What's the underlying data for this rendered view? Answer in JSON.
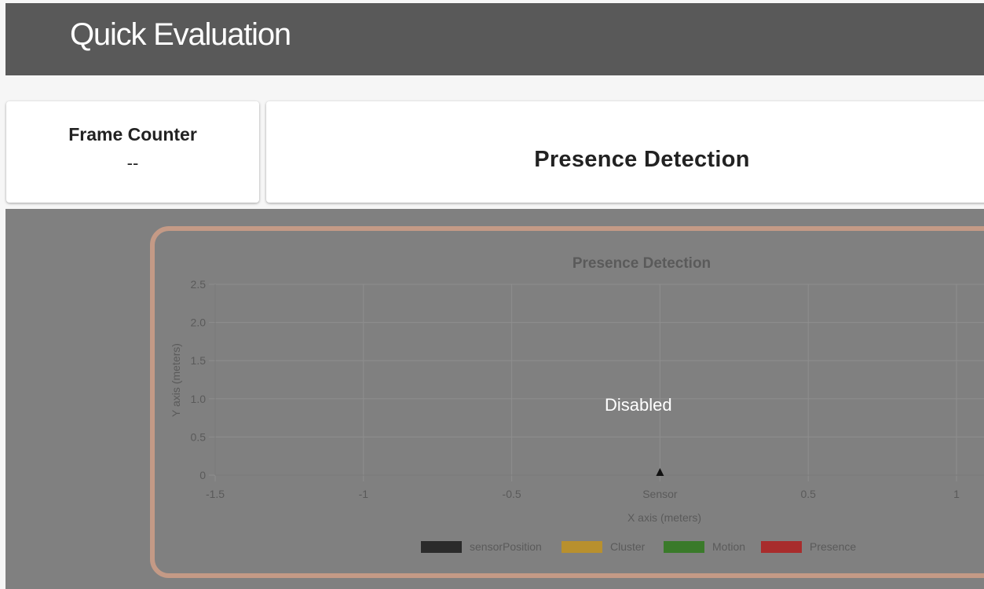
{
  "header": {
    "title": "Quick Evaluation"
  },
  "frame_counter": {
    "label": "Frame Counter",
    "value": "--"
  },
  "presence_card": {
    "title": "Presence Detection"
  },
  "overlay": {
    "status": "Disabled"
  },
  "chart_data": {
    "type": "scatter",
    "title": "Presence Detection",
    "xlabel": "X axis (meters)",
    "ylabel": "Y axis (meters)",
    "xlim": [
      -1.5,
      1.1
    ],
    "ylim": [
      0,
      2.5
    ],
    "x_ticks": [
      {
        "value": -1.5,
        "label": "-1.5"
      },
      {
        "value": -1,
        "label": "-1"
      },
      {
        "value": -0.5,
        "label": "-0.5"
      },
      {
        "value": 0,
        "label": "Sensor"
      },
      {
        "value": 0.5,
        "label": "0.5"
      },
      {
        "value": 1,
        "label": "1"
      }
    ],
    "y_ticks": [
      {
        "value": 0,
        "label": "0"
      },
      {
        "value": 0.5,
        "label": "0.5"
      },
      {
        "value": 1.0,
        "label": "1.0"
      },
      {
        "value": 1.5,
        "label": "1.5"
      },
      {
        "value": 2.0,
        "label": "2.0"
      },
      {
        "value": 2.5,
        "label": "2.5"
      }
    ],
    "grid": true,
    "legend_position": "bottom",
    "series": [
      {
        "name": "sensorPosition",
        "color": "#2b2b2b",
        "points": [
          {
            "x": 0,
            "y": 0
          }
        ]
      },
      {
        "name": "Cluster",
        "color": "#b8902e",
        "points": []
      },
      {
        "name": "Motion",
        "color": "#3a7a2a",
        "points": []
      },
      {
        "name": "Presence",
        "color": "#a82c2c",
        "points": []
      }
    ]
  }
}
